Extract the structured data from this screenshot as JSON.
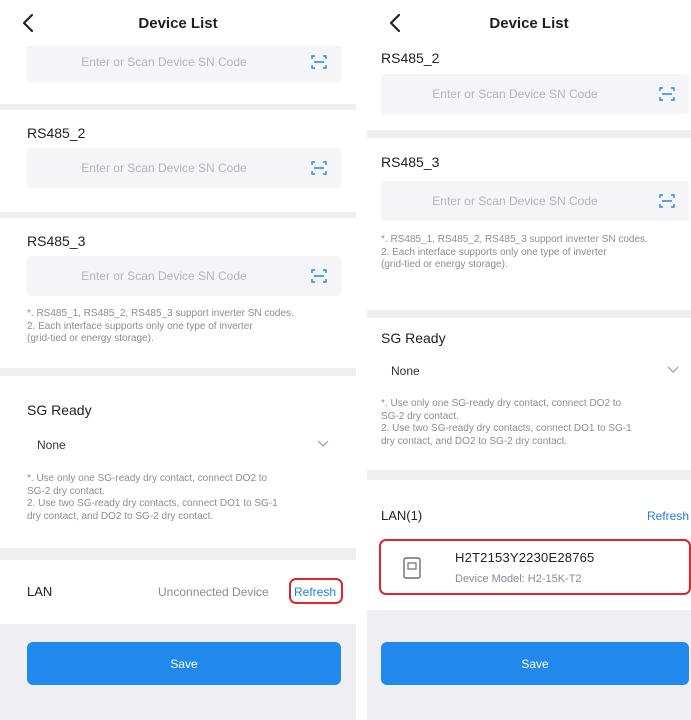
{
  "left": {
    "header": {
      "title": "Device List"
    },
    "top_input": {
      "placeholder": "Enter or Scan Device SN Code"
    },
    "rs485_2": {
      "label": "RS485_2",
      "placeholder": "Enter or Scan Device SN Code"
    },
    "rs485_3": {
      "label": "RS485_3",
      "placeholder": "Enter or Scan Device SN Code",
      "note_lines": [
        "*. RS485_1, RS485_2, RS485_3 support inverter SN codes.",
        "2. Each interface supports only one type of inverter",
        "(grid-tied or energy storage)."
      ]
    },
    "sg_ready": {
      "label": "SG Ready",
      "value": "None",
      "note_lines": [
        "*. Use only one SG-ready dry contact, connect DO2 to",
        "SG-2 dry contact.",
        "2. Use two SG-ready dry contacts, connect DO1 to SG-1",
        "dry contact, and DO2 to SG-2 dry contact."
      ]
    },
    "lan": {
      "label": "LAN",
      "status": "Unconnected Device",
      "refresh": "Refresh"
    },
    "save": "Save"
  },
  "right": {
    "header": {
      "title": "Device List"
    },
    "rs485_2": {
      "label": "RS485_2",
      "placeholder": "Enter or Scan Device SN Code"
    },
    "rs485_3": {
      "label": "RS485_3",
      "placeholder": "Enter or Scan Device SN Code",
      "note_lines": [
        "*. RS485_1, RS485_2, RS485_3 support inverter SN codes.",
        "2. Each interface supports only one type of inverter",
        "(grid-tied or energy storage)."
      ]
    },
    "sg_ready": {
      "label": "SG Ready",
      "value": "None",
      "note_lines": [
        "*. Use only one SG-ready dry contact, connect DO2 to",
        "SG-2 dry contact.",
        "2. Use two SG-ready dry contacts, connect DO1 to SG-1",
        "dry contact, and DO2 to SG-2 dry contact."
      ]
    },
    "lan": {
      "label": "LAN(1)",
      "refresh": "Refresh",
      "device": {
        "sn": "H2T2153Y2230E28765",
        "model": "Device Model: H2-15K-T2"
      }
    },
    "save": "Save"
  },
  "icons": [
    "back-chevron-icon",
    "scan-icon",
    "chevron-down-icon",
    "inverter-device-icon"
  ],
  "colors": {
    "accent": "#2189ec",
    "highlight": "#e0262a",
    "link": "#1f7fd8"
  }
}
